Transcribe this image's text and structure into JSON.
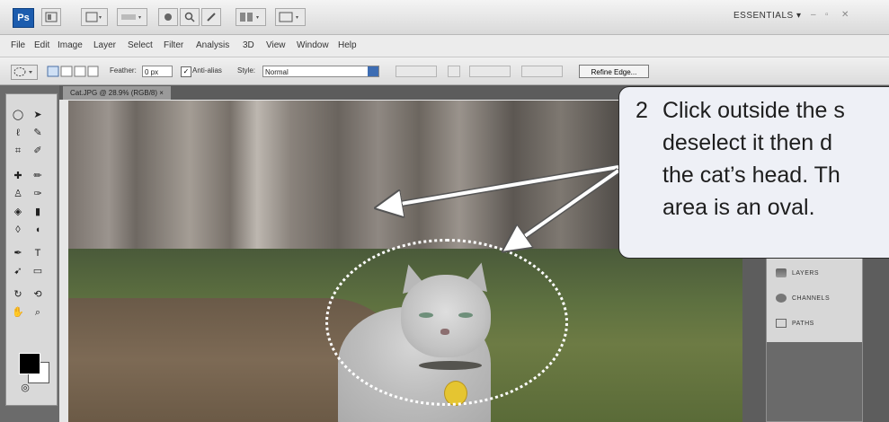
{
  "app": {
    "workspace_label": "ESSENTIALS ▾",
    "window_controls": [
      "–",
      "▫",
      "✕"
    ]
  },
  "menubar": {
    "items": [
      "File",
      "Edit",
      "Image",
      "Layer",
      "Select",
      "Filter",
      "Analysis",
      "3D",
      "View",
      "Window",
      "Help"
    ]
  },
  "options": {
    "feather_label": "Feather:",
    "feather_value": "0 px",
    "antialias_label": "Anti-alias",
    "style_label": "Style:",
    "style_value": "Normal",
    "refine_label": "Refine Edge..."
  },
  "document": {
    "tab_label": "Cat.JPG @ 28.9% (RGB/8) ×"
  },
  "panels": {
    "items": [
      "LAYERS",
      "CHANNELS",
      "PATHS"
    ]
  },
  "callout": {
    "number": "2",
    "lines": [
      "Click outside the s",
      "deselect it then d",
      "the cat’s head.  Th",
      "area is an oval."
    ]
  },
  "colors": {
    "callout_bg": "#eef0f6",
    "arrow": "#ffffff",
    "foreground": "#000000",
    "background": "#ffffff"
  }
}
